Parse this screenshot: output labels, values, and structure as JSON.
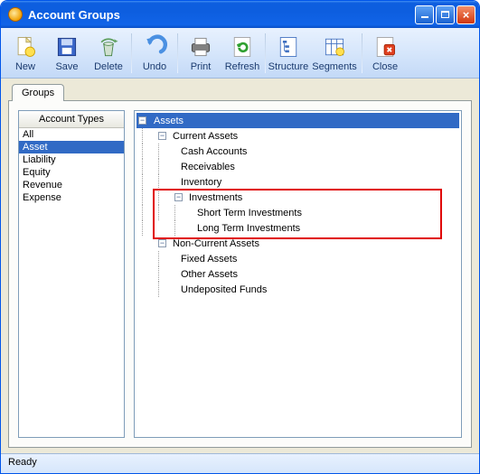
{
  "window": {
    "title": "Account Groups"
  },
  "toolbar": {
    "new": "New",
    "save": "Save",
    "delete": "Delete",
    "undo": "Undo",
    "print": "Print",
    "refresh": "Refresh",
    "structure": "Structure",
    "segments": "Segments",
    "close": "Close"
  },
  "tabs": {
    "groups": "Groups"
  },
  "account_types": {
    "header": "Account Types",
    "items": [
      "All",
      "Asset",
      "Liability",
      "Equity",
      "Revenue",
      "Expense"
    ],
    "selected": "Asset"
  },
  "tree": {
    "root": "Assets",
    "current_assets": "Current Assets",
    "cash_accounts": "Cash Accounts",
    "receivables": "Receivables",
    "inventory": "Inventory",
    "investments": "Investments",
    "short_term_investments": "Short Term Investments",
    "long_term_investments": "Long Term Investments",
    "non_current_assets": "Non-Current Assets",
    "fixed_assets": "Fixed Assets",
    "other_assets": "Other Assets",
    "undeposited_funds": "Undeposited Funds"
  },
  "status": {
    "text": "Ready"
  }
}
